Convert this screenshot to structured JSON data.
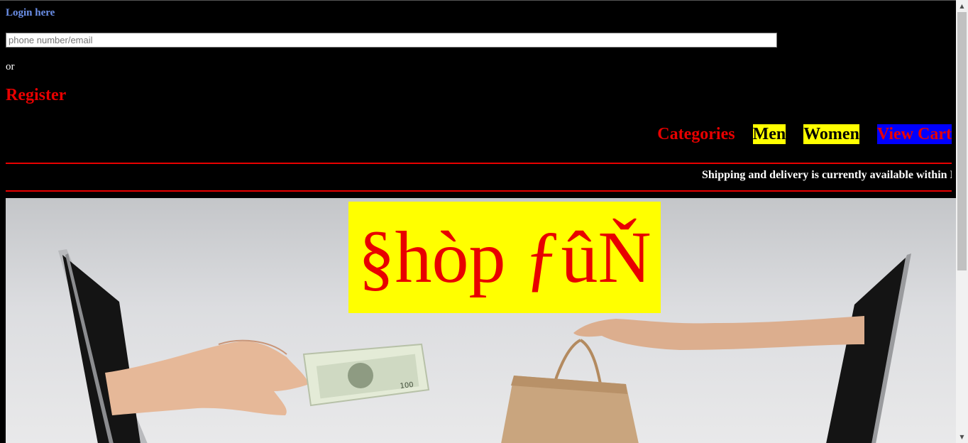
{
  "login": {
    "link_label": "Login here",
    "input_placeholder": "phone number/email",
    "input_value": ""
  },
  "or_text": "or",
  "register_label": "Register",
  "nav": {
    "categories": "Categories",
    "men": "Men",
    "women": "Women",
    "cart": "View Cart"
  },
  "marquee_text": "Shipping and delivery is currently available within I",
  "hero": {
    "logo_text": "§hòp ƒûŇ",
    "logo_colors": {
      "text": "#e80000",
      "background": "#ffff00"
    }
  },
  "colors": {
    "page_background": "#000000",
    "accent_red": "#e80000",
    "login_link": "#6b8fe8",
    "cart_background": "#0000ff",
    "highlight_yellow": "#ffff00"
  }
}
